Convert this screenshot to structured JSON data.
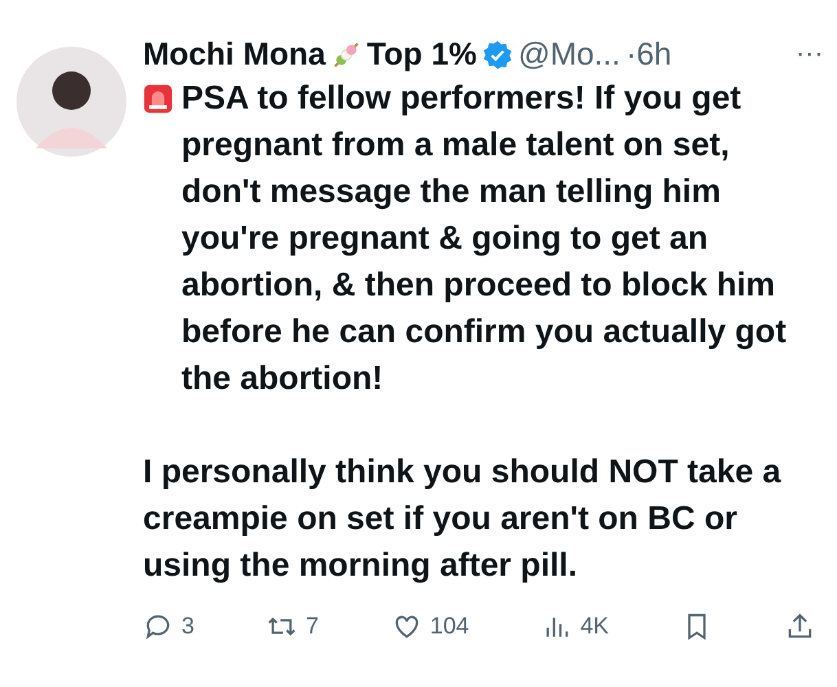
{
  "tweet": {
    "name": "Mochi Mona",
    "badge_text": "Top 1%",
    "verified": true,
    "handle": "@Mo...",
    "time": "·6h",
    "more": "···",
    "paragraphs": [
      "PSA to fellow performers! If you get pregnant from a male talent on set, don't message the man telling him you're pregnant & going to get an abortion, & then proceed to block him before he can confirm you actually got the abortion!",
      "I personally think you should NOT take a creampie on set if you aren't on BC or using the morning after pill."
    ],
    "actions": [
      {
        "kind": "reply",
        "count": "3"
      },
      {
        "kind": "repost",
        "count": "7"
      },
      {
        "kind": "like",
        "count": "104"
      },
      {
        "kind": "views",
        "count": "4K"
      },
      {
        "kind": "bookmark"
      },
      {
        "kind": "share"
      }
    ]
  }
}
